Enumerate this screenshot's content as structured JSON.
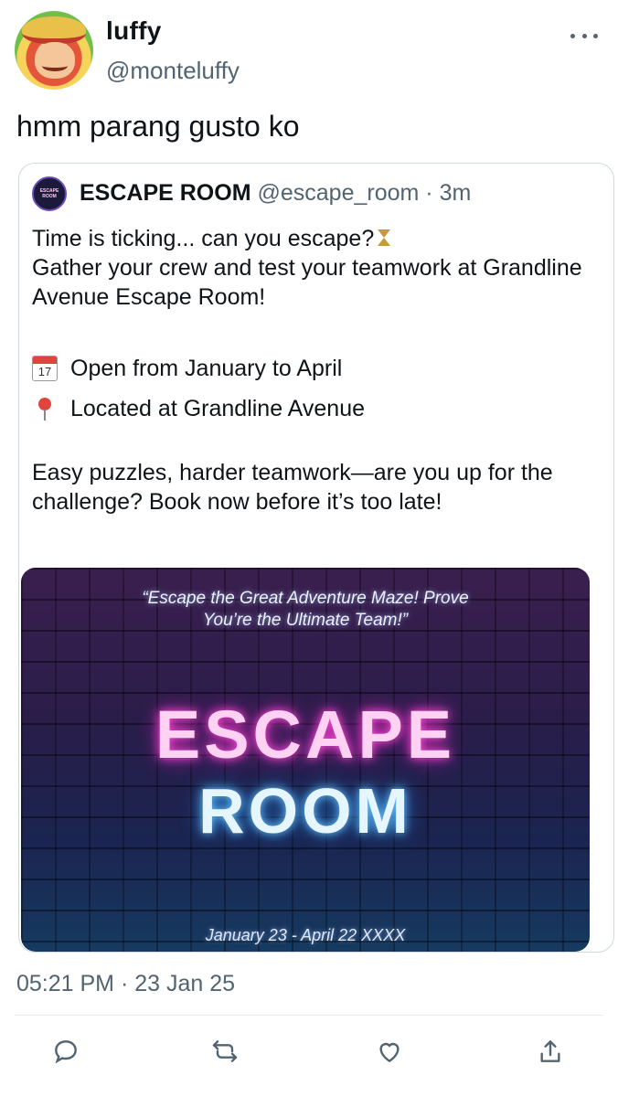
{
  "user": {
    "display_name": "luffy",
    "handle": "@monteluffy",
    "avatar_icon": "anime-character-avatar"
  },
  "tweet": {
    "text": "hmm parang gusto ko",
    "timestamp": "05:21 PM · 23 Jan 25"
  },
  "quote": {
    "avatar_text_1": "ESCAPE",
    "avatar_text_2": "ROOM",
    "name": "ESCAPE ROOM",
    "handle": "@escape_room",
    "separator": " · ",
    "time": "3m",
    "line1": "Time is ticking... can you escape?",
    "line2": "Gather your crew and test your teamwork at Grandline Avenue Escape Room!",
    "bullet1_icon_text": "17",
    "bullet1": "Open from January to April",
    "bullet2": "Located at Grandline Avenue",
    "line3": "Easy puzzles, harder teamwork—are you up for the challenge? Book now before it’s too late!"
  },
  "poster": {
    "tagline_1": "“Escape the Great Adventure Maze! Prove",
    "tagline_2": "You’re the Ultimate Team!”",
    "title_1": "ESCAPE",
    "title_2": "ROOM",
    "dates": "January 23 - April 22 XXXX",
    "colors": {
      "title_1_glow": "#ff4fd8",
      "title_2_glow": "#6ec8ff",
      "wall": "#2a1d4a"
    }
  },
  "actions": [
    {
      "icon": "reply-icon"
    },
    {
      "icon": "retweet-icon"
    },
    {
      "icon": "like-icon"
    },
    {
      "icon": "share-icon"
    }
  ],
  "colors": {
    "text": "#0f1419",
    "secondary": "#536471",
    "border": "#cfd9de"
  }
}
